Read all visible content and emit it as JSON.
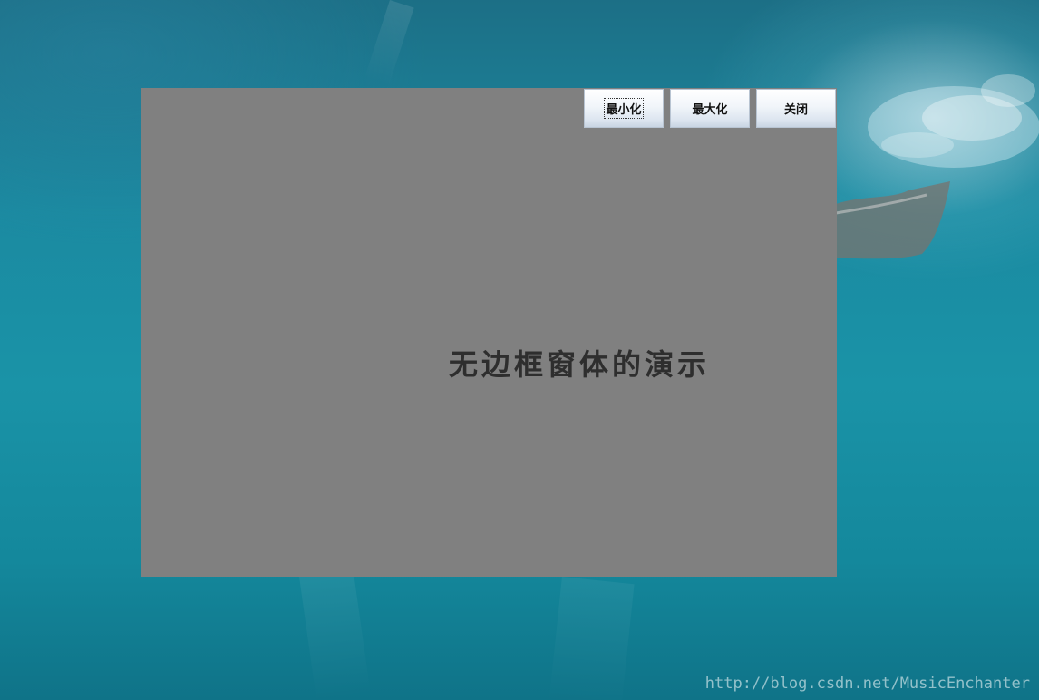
{
  "window": {
    "buttons": {
      "minimize": "最小化",
      "maximize": "最大化",
      "close": "关闭"
    },
    "content_text": "无边框窗体的演示",
    "background_color": "#808080"
  },
  "watermark": "http://blog.csdn.net/MusicEnchanter",
  "colors": {
    "desktop_water": "#1a93a7",
    "button_gradient_top": "#ffffff",
    "button_gradient_bottom": "#c9d5e3"
  }
}
